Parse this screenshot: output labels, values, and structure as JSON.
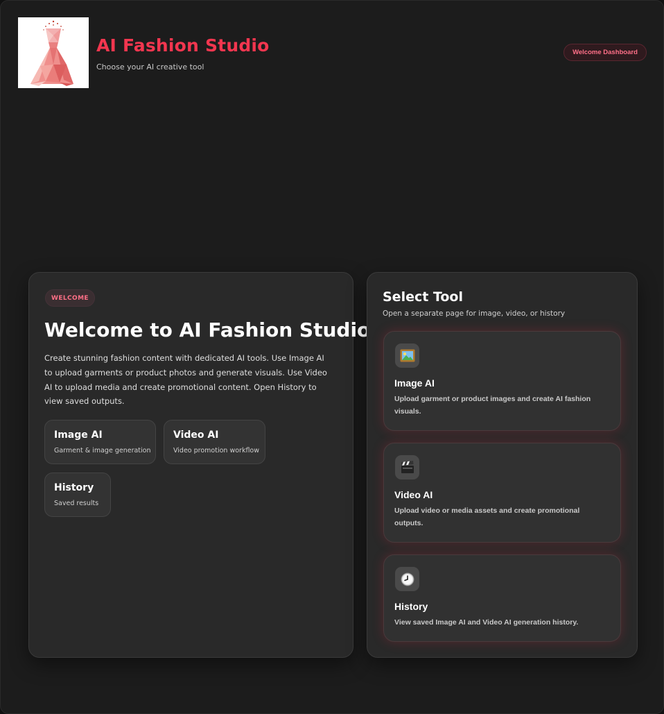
{
  "header": {
    "title": "AI Fashion Studio",
    "subtitle": "Choose your AI creative tool",
    "badge": "Welcome Dashboard"
  },
  "welcome": {
    "pill": "WELCOME",
    "heading": "Welcome to AI Fashion Studio",
    "body": "Create stunning fashion content with dedicated AI tools. Use Image AI to upload garments or product photos and generate visuals. Use Video AI to upload media and create promotional content. Open History to view saved outputs.",
    "shortcuts": [
      {
        "title": "Image AI",
        "subtitle": "Garment & image generation"
      },
      {
        "title": "Video AI",
        "subtitle": "Video promotion workflow"
      },
      {
        "title": "History",
        "subtitle": "Saved results"
      }
    ]
  },
  "tools": {
    "heading": "Select Tool",
    "subheading": "Open a separate page for image, video, or history",
    "items": [
      {
        "name": "Image AI",
        "description": "Upload garment or product images and create AI fashion visuals.",
        "icon": "framed-picture-icon"
      },
      {
        "name": "Video AI",
        "description": "Upload video or media assets and create promotional outputs.",
        "icon": "clapper-board-icon"
      },
      {
        "name": "History",
        "description": "View saved Image AI and Video AI generation history.",
        "icon": "clock-icon"
      }
    ]
  },
  "colors": {
    "accent": "#f2364f",
    "background": "#1c1c1c",
    "panel": "#292929"
  }
}
